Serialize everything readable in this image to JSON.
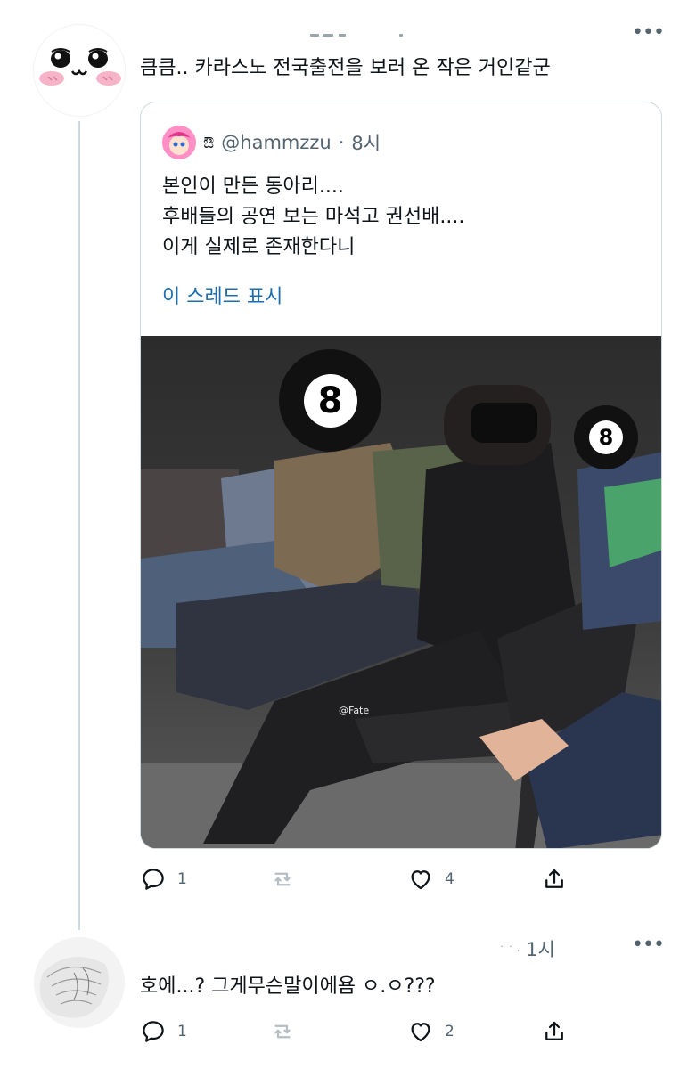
{
  "tweet1": {
    "text": "큼큼.. 카라스노 전국출전을 보러 온 작은 거인같군",
    "quote": {
      "emoji": "ಔ",
      "handle": "@hammzzu",
      "separator": "·",
      "time": "8시",
      "lines": [
        "본인이 만든 동아리....",
        "후배들의 공연 보는 마석고 권선배....",
        "이게 실제로 존재한다니"
      ],
      "show_thread": "이 스레드 표시",
      "photo_watermark": "@Fate",
      "ball_label": "8"
    },
    "actions": {
      "reply_count": "1",
      "retweet_count": "",
      "like_count": "4"
    }
  },
  "tweet2": {
    "time": "1시",
    "text": "호에...? 그게무슨말이에욤 ㅇ.ㅇ???",
    "actions": {
      "reply_count": "1",
      "retweet_count": "",
      "like_count": "2"
    }
  },
  "icons": {
    "more": "more-horizontal-icon",
    "reply": "reply-icon",
    "retweet": "retweet-icon",
    "like": "heart-icon",
    "share": "share-icon"
  },
  "colors": {
    "text": "#0f1419",
    "secondary": "#536471",
    "link": "#1b6fb0",
    "border": "#cfd9de"
  }
}
